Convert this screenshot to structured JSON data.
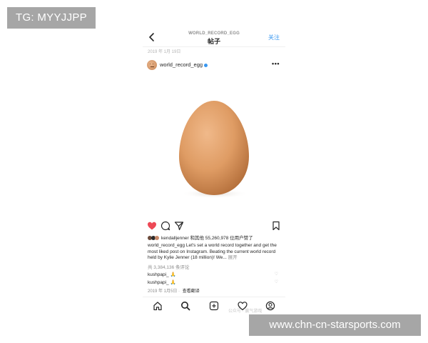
{
  "overlay": {
    "top_left_badge": "TG: MYYJJPP",
    "bottom_right_badge": "www.chn-cn-starsports.com"
  },
  "nav": {
    "subtitle": "WORLD_RECORD_EGG",
    "title": "帖子",
    "follow_label": "关注",
    "back_icon": "chevron-left-icon"
  },
  "post": {
    "date_top": "2019 年 1月 19日",
    "username": "world_record_egg",
    "more_label": "•••",
    "likes": {
      "prefix_user": "kendalljenner",
      "text": " 和其他 55,260,978 位用户赞了"
    },
    "caption": {
      "username": "world_record_egg",
      "text": " Let's set a world record together and get the most liked post on Instagram. Beating the current world record held by Kylie Jenner (18 million)! We...",
      "more": " 展开"
    },
    "comments_count": "共 3,384,136 条评论",
    "comments": [
      {
        "user": "kushpapi_",
        "text": " 🙏"
      },
      {
        "user": "kushpapi_",
        "text": " 🙏"
      }
    ],
    "date_bottom": "2019 年 1月5日",
    "translate_label": "查看翻译"
  },
  "colors": {
    "like_red": "#ed4956",
    "link_blue": "#3897f0",
    "egg_light": "#e8a774",
    "egg_dark": "#b5703c"
  },
  "tabbar": {
    "items": [
      "home-icon",
      "search-icon",
      "add-icon",
      "heart-icon",
      "profile-icon"
    ]
  },
  "watermark": "公众号 · 赢气游戏"
}
